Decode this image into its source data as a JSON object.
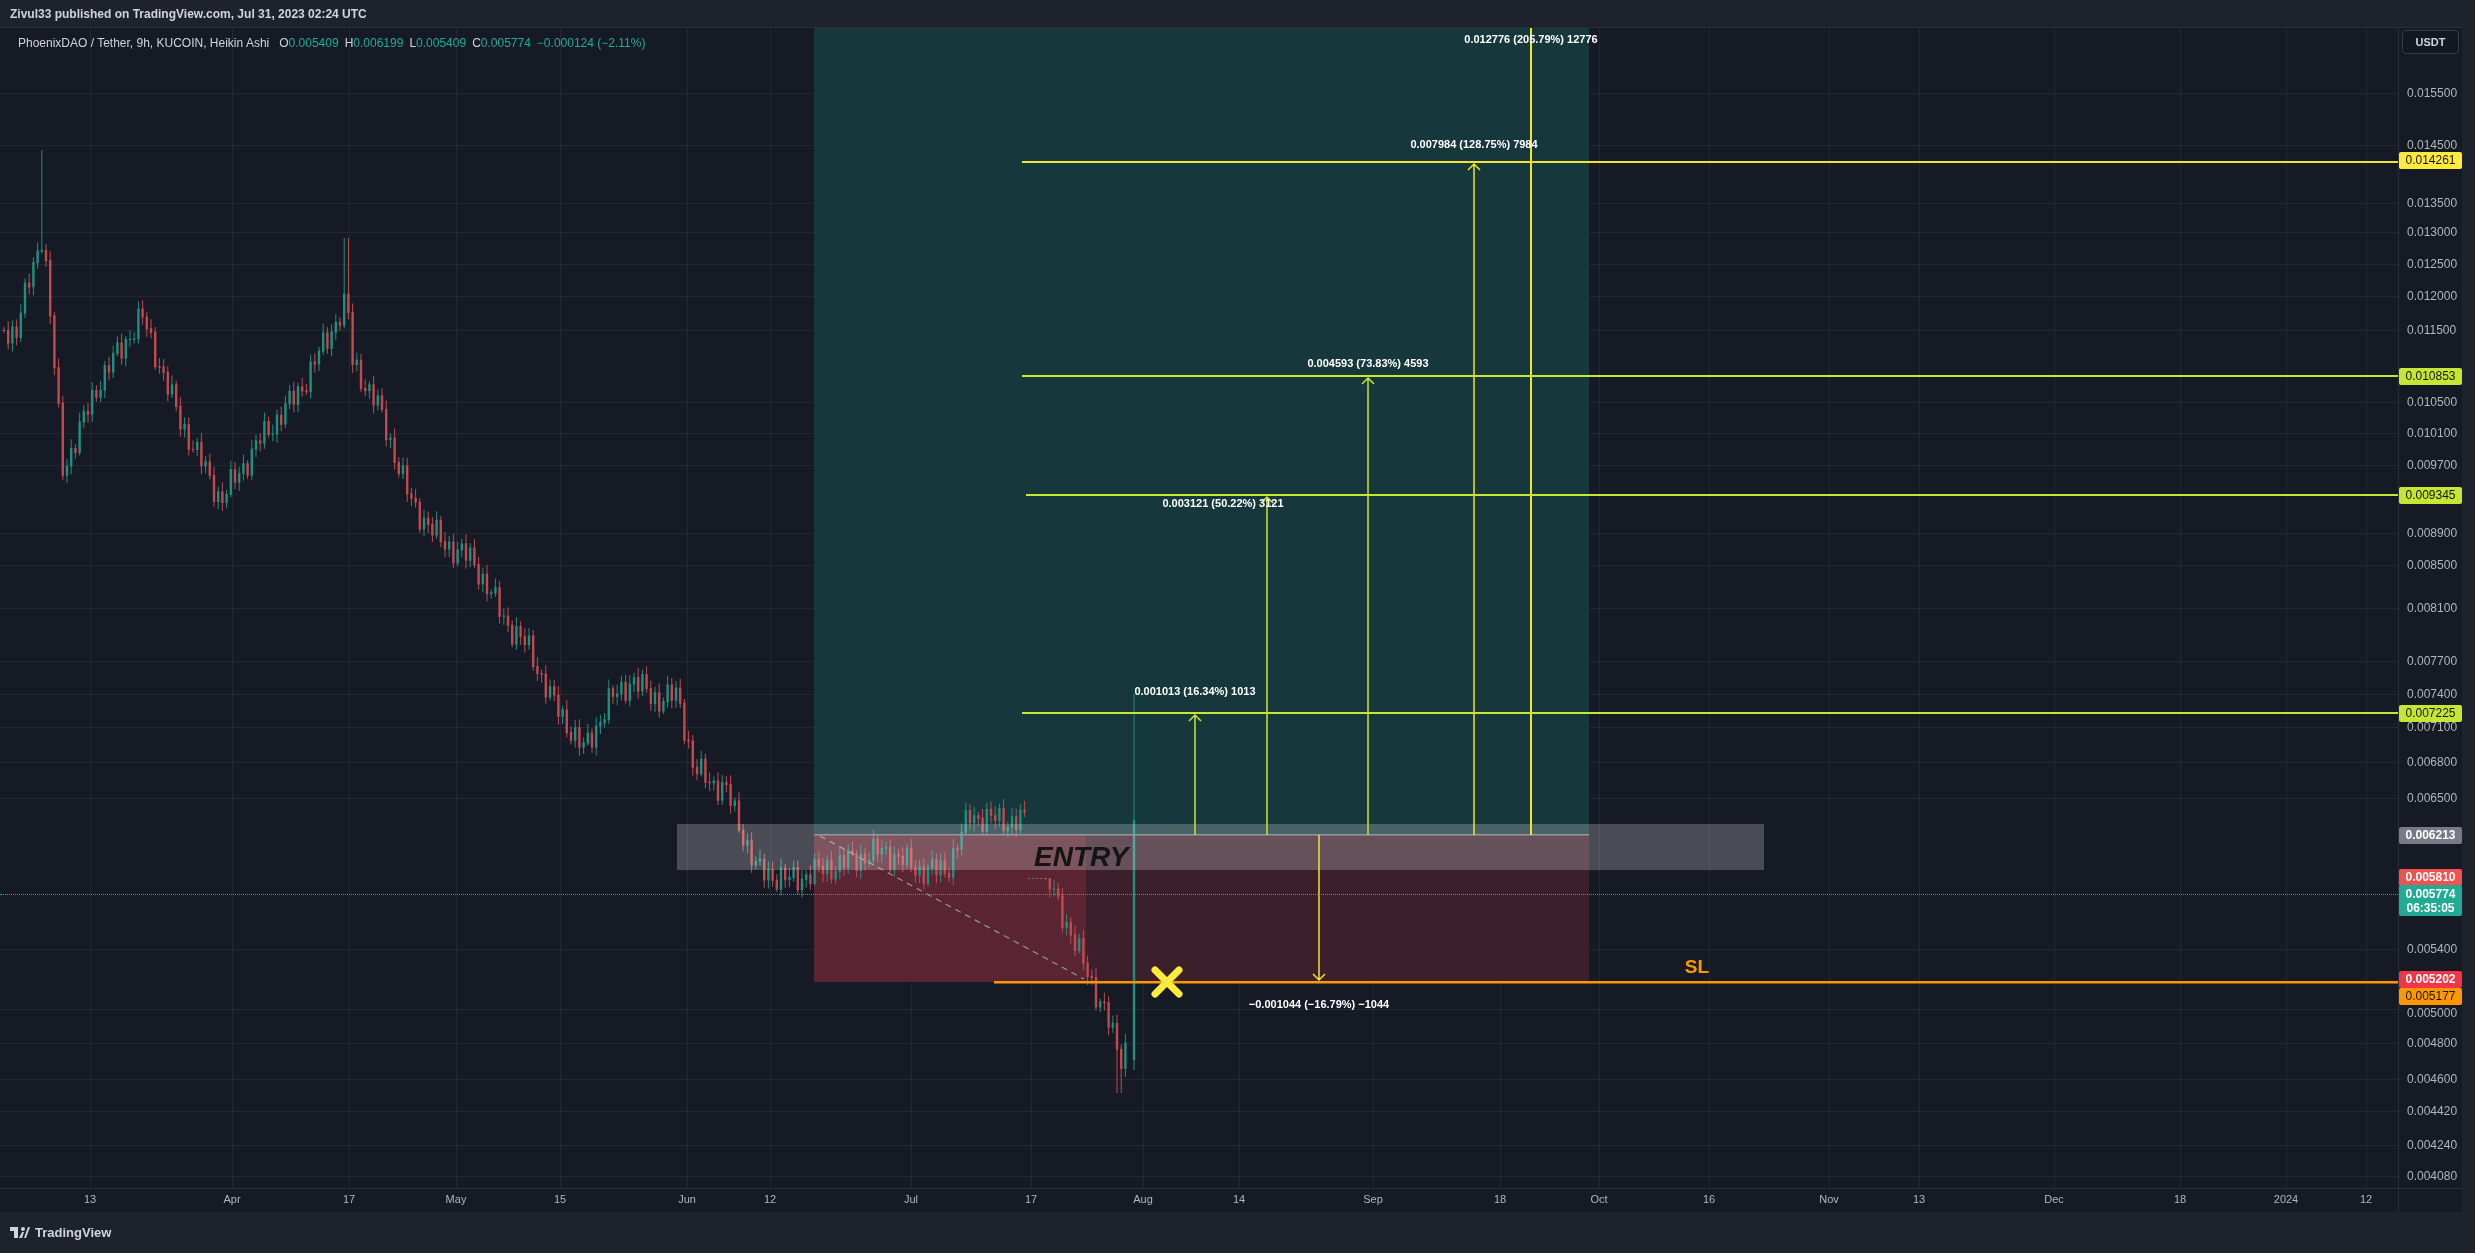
{
  "header": {
    "publisher_line": "Zivul33 published on TradingView.com, Jul 31, 2023 02:24 UTC"
  },
  "legend": {
    "symbol": "PhoenixDAO / Tether, 9h, KUCOIN, Heikin Ashi",
    "values": [
      {
        "label": "O",
        "value": "0.005409"
      },
      {
        "label": "H",
        "value": "0.006199"
      },
      {
        "label": "L",
        "value": "0.005409"
      },
      {
        "label": "C",
        "value": "0.005774"
      }
    ],
    "change": "−0.000124 (−2.11%)"
  },
  "drawings": {
    "targets": [
      {
        "kind": "ray",
        "label": "0.012776 (205.79%) 12776",
        "color": "#f2e231"
      },
      {
        "kind": "level",
        "label": "0.007984 (128.75%) 7984",
        "color": "#f2e231"
      },
      {
        "kind": "level",
        "label": "0.004593 (73.83%) 4593",
        "color": "#c5e633"
      },
      {
        "kind": "level",
        "label": "0.003121 (50.22%) 3121",
        "color": "#c5e633"
      },
      {
        "kind": "level",
        "label": "0.001013 (16.34%) 1013",
        "color": "#c5e633"
      }
    ],
    "entry_label": "ENTRY",
    "stop": {
      "label": "SL",
      "measure": "−0.001044 (−16.79%) −1044"
    }
  },
  "price_axis": {
    "currency_button": "USDT",
    "ticks": [
      "0.015500",
      "0.014500",
      "0.013500",
      "0.013000",
      "0.012500",
      "0.012000",
      "0.011500",
      "0.010500",
      "0.010100",
      "0.009700",
      "0.008900",
      "0.008500",
      "0.008100",
      "0.007700",
      "0.007400",
      "0.007100",
      "0.006800",
      "0.006500",
      "0.005400",
      "0.005000",
      "0.004800",
      "0.004600",
      "0.004420",
      "0.004240",
      "0.004080"
    ],
    "badges": [
      {
        "text": "0.014261",
        "color": "#ffeb3b"
      },
      {
        "text": "0.010853",
        "color": "#c5e633"
      },
      {
        "text": "0.009345",
        "color": "#c5e633"
      },
      {
        "text": "0.007225",
        "color": "#c5e633"
      },
      {
        "text": "0.006213",
        "color": "#787b86"
      },
      {
        "text": "0.005810",
        "color": "#ef5350"
      },
      {
        "text": "0.005202",
        "color": "#f23645"
      },
      {
        "text": "0.005177",
        "color": "#ff9800"
      }
    ],
    "current_price": {
      "price": "0.005774",
      "countdown": "06:35:05",
      "color": "#22ab94"
    }
  },
  "time_axis": {
    "ticks": [
      "13",
      "Apr",
      "17",
      "May",
      "15",
      "Jun",
      "12",
      "Jul",
      "17",
      "Aug",
      "14",
      "Sep",
      "18",
      "Oct",
      "16",
      "Nov",
      "13",
      "Dec",
      "18",
      "2024",
      "12"
    ]
  },
  "footer": {
    "logo_text": "TradingView"
  }
}
